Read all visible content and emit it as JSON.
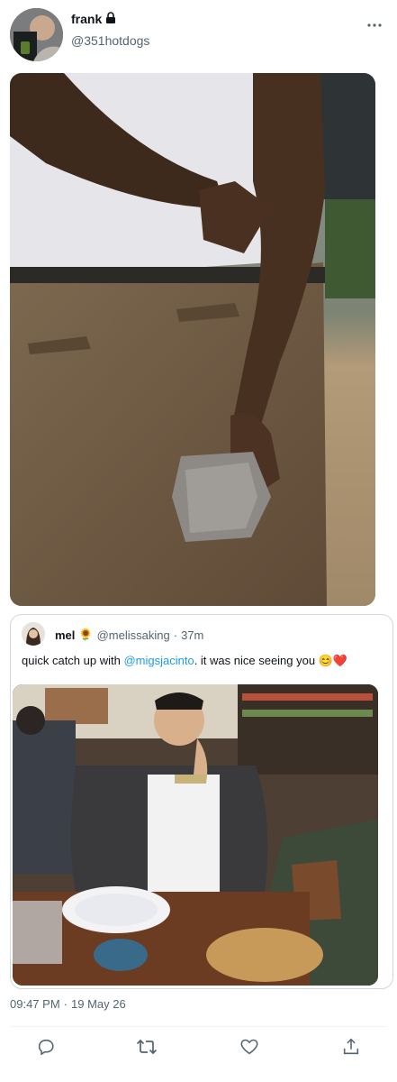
{
  "author": {
    "display_name": "frank",
    "handle": "@351hotdogs",
    "avatar_icon": "avatar",
    "lock_icon": "lock-icon"
  },
  "more_icon": "more-horizontal-icon",
  "quote": {
    "name": "mel",
    "name_emoji": "🌻",
    "handle": "@melissaking",
    "separator": "·",
    "time": "37m",
    "text_before": "quick catch up with ",
    "mention": "@migsjacinto",
    "text_after": ". it was nice seeing you 😊❤️"
  },
  "timestamp": {
    "time": "09:47 PM",
    "separator": "·",
    "date": "19 May 26"
  },
  "actions": [
    {
      "icon": "reply-icon"
    },
    {
      "icon": "retweet-icon"
    },
    {
      "icon": "like-icon"
    },
    {
      "icon": "share-icon"
    }
  ],
  "colors": {
    "link": "#1d9bf0",
    "secondary_text": "#536471",
    "primary_text": "#0f1419",
    "border": "#cfd9de"
  }
}
